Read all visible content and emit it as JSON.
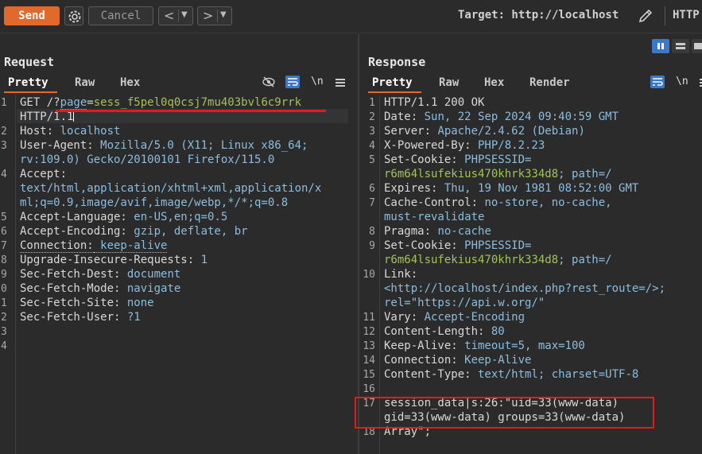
{
  "toolbar": {
    "send_label": "Send",
    "cancel_label": "Cancel",
    "back_arrow": "<",
    "forward_arrow": ">",
    "target_label": "Target: http://localhost",
    "http_label": "HTTP"
  },
  "request": {
    "title": "Request",
    "tabs": [
      "Pretty",
      "Raw",
      "Hex"
    ],
    "newline_toggle": "\\n",
    "lines": {
      "l1_method": "GET /?",
      "l1_param": "page",
      "l1_eq": "=",
      "l1_value": "sess_f5pel0q0csj7mu403bvl6c9rrk",
      "l1_proto": "HTTP/1.1",
      "l2_name": "Host:",
      "l2_value": " localhost",
      "l3_name": "User-Agent:",
      "l3_value": " Mozilla/5.0 (X11; Linux x86_64;",
      "l3_cont": "rv:109.0) Gecko/20100101 Firefox/115.0",
      "l4_name": "Accept:",
      "l4_cont1": "text/html,application/xhtml+xml,application/x",
      "l4_cont2": "ml;q=0.9,image/avif,image/webp,*/*;q=0.8",
      "l5_name": "Accept-Language:",
      "l5_value": " en-US,en;q=0.5",
      "l6_name": "Accept-Encoding:",
      "l6_value": " gzip, deflate, br",
      "l7_name": "Connection:",
      "l7_value": " keep-alive",
      "l8_name": "Upgrade-Insecure-Requests:",
      "l8_value": " 1",
      "l9_name": "Sec-Fetch-Dest:",
      "l9_value": " document",
      "l10_name": "Sec-Fetch-Mode:",
      "l10_value": " navigate",
      "l11_name": "Sec-Fetch-Site:",
      "l11_value": " none",
      "l12_name": "Sec-Fetch-User:",
      "l12_value": " ?1"
    },
    "line_numbers": [
      "1",
      "2",
      "3",
      "4",
      "5",
      "6",
      "7",
      "8",
      "9",
      "0",
      "1",
      "2",
      "3",
      "4"
    ]
  },
  "response": {
    "title": "Response",
    "tabs": [
      "Pretty",
      "Raw",
      "Hex",
      "Render"
    ],
    "newline_toggle": "\\n",
    "lines": {
      "l1": "HTTP/1.1 200 OK",
      "l2_name": "Date:",
      "l2_value": " Sun, 22 Sep 2024 09:40:59 GMT",
      "l3_name": "Server:",
      "l3_value": " Apache/2.4.62 (Debian)",
      "l4_name": "X-Powered-By:",
      "l4_value": " PHP/8.2.23",
      "l5_name": "Set-Cookie:",
      "l5_value": " PHPSESSID=",
      "l5_cont": "r6m64lsufekius470khrk334d8",
      "l5_tail": "; path=/",
      "l6_name": "Expires:",
      "l6_value": " Thu, 19 Nov 1981 08:52:00 GMT",
      "l7_name": "Cache-Control:",
      "l7_value": " no-store, no-cache,",
      "l7_cont": "must-revalidate",
      "l8_name": "Pragma:",
      "l8_value": " no-cache",
      "l9_name": "Set-Cookie:",
      "l9_value": " PHPSESSID=",
      "l9_cont": "r6m64lsufekius470khrk334d8",
      "l9_tail": "; path=/",
      "l10_name": "Link:",
      "l10_cont1": "<http://localhost/index.php?rest_route=/>;",
      "l10_cont2": "rel=\"https://api.w.org/\"",
      "l11_name": "Vary:",
      "l11_value": " Accept-Encoding",
      "l12_name": "Content-Length:",
      "l12_value": " 80",
      "l13_name": "Keep-Alive:",
      "l13_value": " timeout=5, max=100",
      "l14_name": "Connection:",
      "l14_value": " Keep-Alive",
      "l15_name": "Content-Type:",
      "l15_value": " text/html; charset=UTF-8",
      "l17_a": "session_data|s:26:\"uid=33(www-data)",
      "l17_b": "gid=33(www-data) groups=33(www-data)",
      "l18": "Array\";"
    },
    "line_numbers": [
      "1",
      "2",
      "3",
      "4",
      "5",
      "6",
      "7",
      "8",
      "9",
      "10",
      "11",
      "12",
      "13",
      "14",
      "15",
      "16",
      "17",
      "18"
    ]
  },
  "colors": {
    "accent": "#e0692b",
    "highlight_red": "#e21b1b",
    "header_value_blue": "#8bbdde",
    "cookie_green": "#a2c25a",
    "toggle_blue": "#3b78c9"
  },
  "icons": [
    "gear-icon",
    "pencil-icon",
    "eye-slash-icon",
    "wrap-icon",
    "menu-icon",
    "split-view-icon"
  ]
}
